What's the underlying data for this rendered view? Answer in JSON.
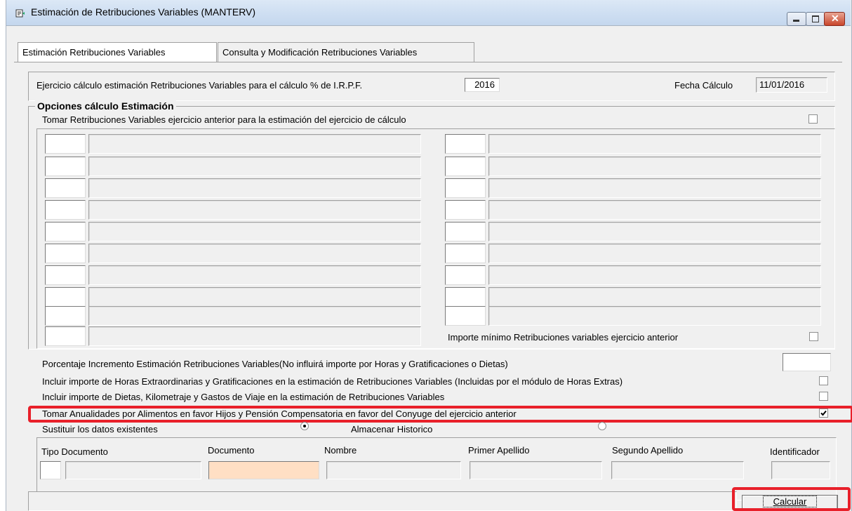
{
  "window": {
    "title": "Estimación de Retribuciones Variables  (MANTERV)"
  },
  "tabs": [
    {
      "label": "Estimación Retribuciones Variables"
    },
    {
      "label": "Consulta y  Modificación Retribuciones Variables"
    }
  ],
  "header": {
    "ejercicio_label": "Ejercicio cálculo estimación Retribuciones Variables para el cálculo % de I.R.P.F.",
    "ejercicio_value": "2016",
    "fecha_label": "Fecha Cálculo",
    "fecha_value": "11/01/2016"
  },
  "opciones": {
    "legend": "Opciones cálculo Estimación",
    "tomar_anterior_label": "Tomar Retribuciones Variables ejercicio anterior para la estimación del ejercicio de cálculo",
    "importe_minimo_label": "Importe mínimo Retribuciones variables ejercicio anterior",
    "porcentaje_label": "Porcentaje Incremento Estimación Retribuciones Variables(No influirá importe por Horas y Gratificaciones o Dietas)",
    "incluir_horas_label": "Incluir importe de Horas Extraordinarias y Gratificaciones en la estimación de Retribuciones Variables (Incluidas por el módulo de Horas Extras)",
    "incluir_dietas_label": "Incluir importe de Dietas, Kilometraje y Gastos de Viaje en la estimación de Retribuciones Variables",
    "tomar_anualidades_label": "Tomar Anualidades por Alimentos en favor Hijos y Pensión Compensatoria en favor del Conyuge del ejercicio anterior",
    "tomar_anualidades_checked": true,
    "sustituir_label": "Sustituir los datos existentes",
    "almacenar_label": "Almacenar Historico",
    "selected_option": "sustituir"
  },
  "persona": {
    "tipo_documento": "Tipo Documento",
    "documento": "Documento",
    "nombre": "Nombre",
    "primer_apellido": "Primer Apellido",
    "segundo_apellido": "Segundo Apellido",
    "identificador": "Identificador"
  },
  "buttons": {
    "calcular": "Calcular"
  },
  "colors": {
    "highlight": "#e8202a",
    "documento_field": "#ffdfc4"
  }
}
